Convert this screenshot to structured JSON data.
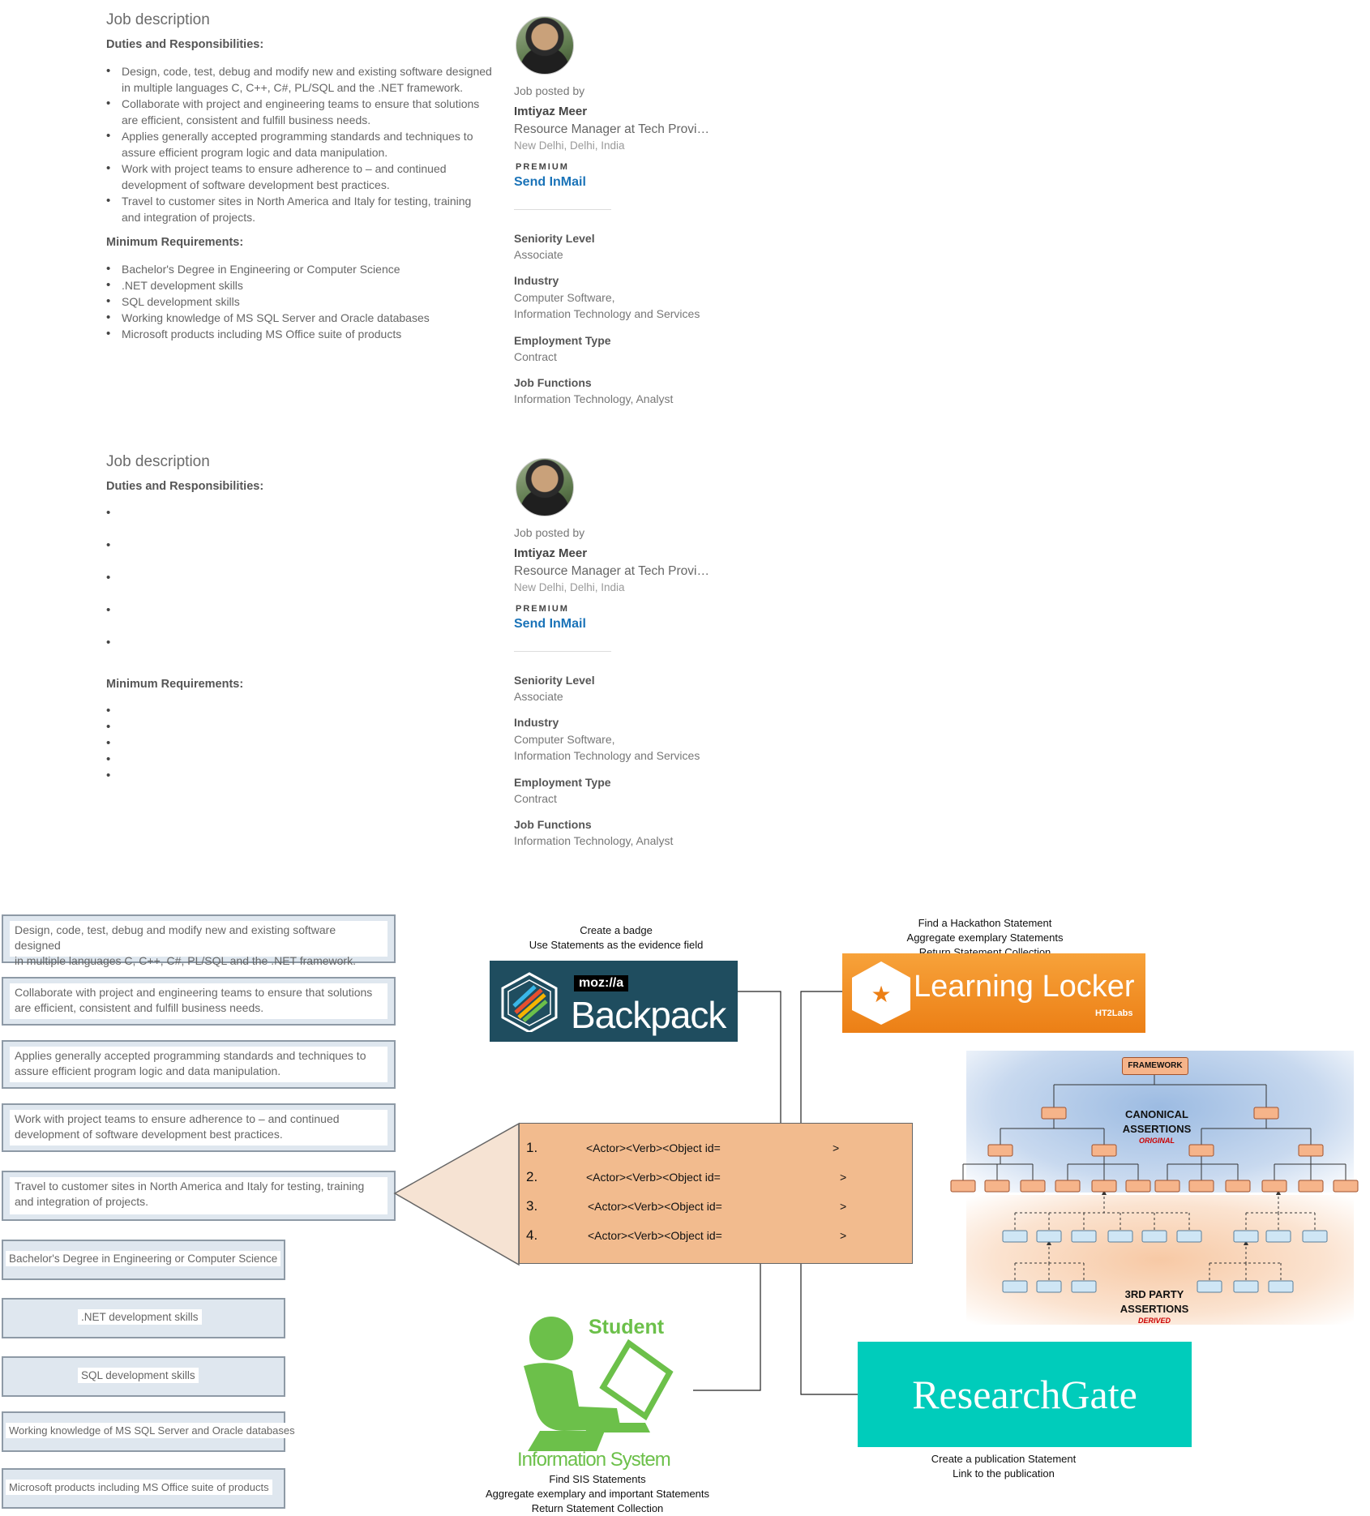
{
  "panels": [
    {
      "job_title": "Job description",
      "duties_heading": "Duties and Responsibilities:",
      "duties": [
        [
          "Design, code, test, debug and modify new and existing software designed",
          "in multiple languages C, C++, C#, PL/SQL and the .NET framework."
        ],
        [
          "Collaborate with project and engineering teams to ensure that solutions",
          "are efficient, consistent and fulfill business needs."
        ],
        [
          "Applies generally accepted programming standards and techniques to",
          "assure efficient program logic and data manipulation."
        ],
        [
          "Work with project teams to ensure adherence to – and continued",
          "development of software development best practices."
        ],
        [
          "Travel to customer sites in North America and Italy for testing, training",
          "and integration of projects."
        ]
      ],
      "req_heading": "Minimum Requirements:",
      "requirements": [
        "Bachelor's Degree in Engineering or Computer Science",
        ".NET development skills",
        "SQL development skills",
        "Working knowledge of MS SQL Server and Oracle databases",
        "Microsoft products including MS Office suite of products"
      ],
      "posted_by_label": "Job posted by",
      "poster_name": "Imtiyaz Meer",
      "poster_title": "Resource Manager at Tech Provi…",
      "poster_location": "New Delhi, Delhi, India",
      "premium": "PREMIUM",
      "inmail": "Send InMail",
      "seniority_label": "Seniority Level",
      "seniority": "Associate",
      "industry_label": "Industry",
      "industry_1": "Computer Software,",
      "industry_2": "Information Technology and Services",
      "employment_label": "Employment Type",
      "employment": "Contract",
      "functions_label": "Job Functions",
      "functions": "Information Technology, Analyst"
    },
    {
      "job_title": "Job description",
      "duties_heading": "Duties and Responsibilities:",
      "req_heading": "Minimum Requirements:",
      "posted_by_label": "Job posted by",
      "poster_name": "Imtiyaz Meer",
      "poster_title": "Resource Manager at Tech Provi…",
      "poster_location": "New Delhi, Delhi, India",
      "premium": "PREMIUM",
      "inmail": "Send InMail",
      "seniority_label": "Seniority Level",
      "seniority": "Associate",
      "industry_label": "Industry",
      "industry_1": "Computer Software,",
      "industry_2": "Information Technology and Services",
      "employment_label": "Employment Type",
      "employment": "Contract",
      "functions_label": "Job Functions",
      "functions": "Information Technology, Analyst"
    }
  ],
  "bullet": "•",
  "extracted": {
    "duties": [
      [
        "Design, code, test, debug and modify new and existing software designed",
        "in multiple languages C, C++, C#, PL/SQL and the .NET framework."
      ],
      [
        "Collaborate with project and engineering teams to ensure that solutions",
        "are efficient, consistent and fulfill business needs."
      ],
      [
        "Applies generally accepted programming standards and techniques to",
        "assure efficient program logic and data manipulation."
      ],
      [
        "Work with project teams to ensure adherence to – and continued",
        "development of software development best practices."
      ],
      [
        "Travel to customer sites in North America and Italy for testing, training",
        "and integration of projects."
      ]
    ],
    "requirements": [
      "Bachelor's Degree in Engineering or Computer Science",
      ".NET development skills",
      "SQL development skills",
      "Working knowledge of MS SQL Server and Oracle databases",
      "Microsoft products including MS Office suite of products"
    ]
  },
  "backpack": {
    "caption_1": "Create a badge",
    "caption_2": "Use Statements as the evidence field",
    "logo_top": "moz://a",
    "logo_text": "Backpack",
    "color": "#1f4d5f"
  },
  "locker": {
    "caption_1": "Find a Hackathon Statement",
    "caption_2": "Aggregate exemplary Statements",
    "caption_3": "Return Statement Collection",
    "logo_text": "Learning Locker",
    "sub": "HT2Labs",
    "color": "#f18a1c"
  },
  "statements": {
    "rows": [
      {
        "num": "1.",
        "text": "<Actor><Verb><Object id=",
        "end": ">"
      },
      {
        "num": "2.",
        "text": "<Actor><Verb><Object id=",
        "end": ">"
      },
      {
        "num": "3.",
        "text": "<Actor><Verb><Object id=",
        "end": ">"
      },
      {
        "num": "4.",
        "text": "<Actor><Verb><Object id=",
        "end": ">"
      }
    ],
    "color": "#f2bb8e"
  },
  "framework": {
    "title": "FRAMEWORK",
    "canonical_1": "CANONICAL",
    "canonical_2": "ASSERTIONS",
    "original": "ORIGINAL",
    "third_1": "3RD PARTY",
    "third_2": "ASSERTIONS",
    "derived": "DERIVED"
  },
  "sis": {
    "word_1": "Student",
    "word_2": "Information System",
    "caption_1": "Find SIS Statements",
    "caption_2": "Aggregate exemplary and important Statements",
    "caption_3": "Return Statement Collection",
    "color": "#6cc04a"
  },
  "researchgate": {
    "logo_text": "ResearchGate",
    "caption_1": "Create a publication Statement",
    "caption_2": "Link to the publication",
    "color": "#00ccbb"
  }
}
